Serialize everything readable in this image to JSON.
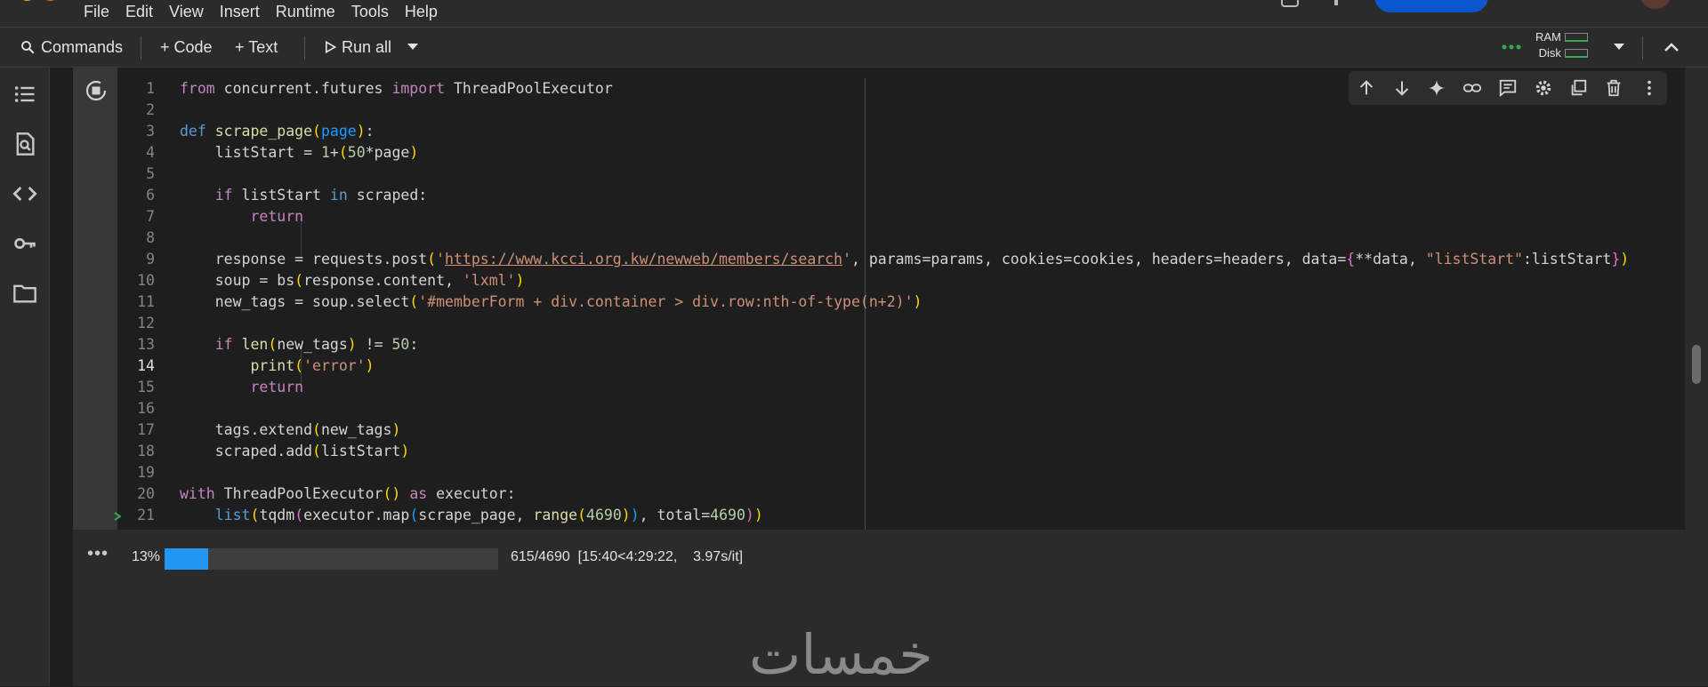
{
  "menubar": {
    "items": [
      "File",
      "Edit",
      "View",
      "Insert",
      "Runtime",
      "Tools",
      "Help"
    ]
  },
  "toolbar": {
    "commands_label": "Commands",
    "code_label": "+ Code",
    "text_label": "+ Text",
    "run_all_label": "Run all",
    "ram_label": "RAM",
    "disk_label": "Disk"
  },
  "sidebar": {
    "icons": [
      "table-of-contents-icon",
      "find-icon",
      "code-snippets-icon",
      "secrets-key-icon",
      "files-folder-icon"
    ]
  },
  "cell": {
    "line_numbers": [
      "1",
      "2",
      "3",
      "4",
      "5",
      "6",
      "7",
      "8",
      "9",
      "10",
      "11",
      "12",
      "13",
      "14",
      "15",
      "16",
      "17",
      "18",
      "19",
      "20",
      "21"
    ],
    "active_line": "14",
    "tools": [
      "move-up-icon",
      "move-down-icon",
      "sparkle-icon",
      "link-icon",
      "comment-icon",
      "settings-gear-icon",
      "mirror-cell-icon",
      "delete-icon",
      "more-vert-icon"
    ]
  },
  "output": {
    "more_label": "•••",
    "progress_percent": "13%",
    "progress_fraction": 0.13,
    "progress_detail": "615/4690  [15:40<4:29:22,    3.97s/it]"
  },
  "watermark": "خمسات",
  "colors": {
    "accent": "#2196f3",
    "keyword": "#c586c0",
    "string": "#ce9178",
    "number": "#b5cea8",
    "status_green": "#34a853"
  }
}
